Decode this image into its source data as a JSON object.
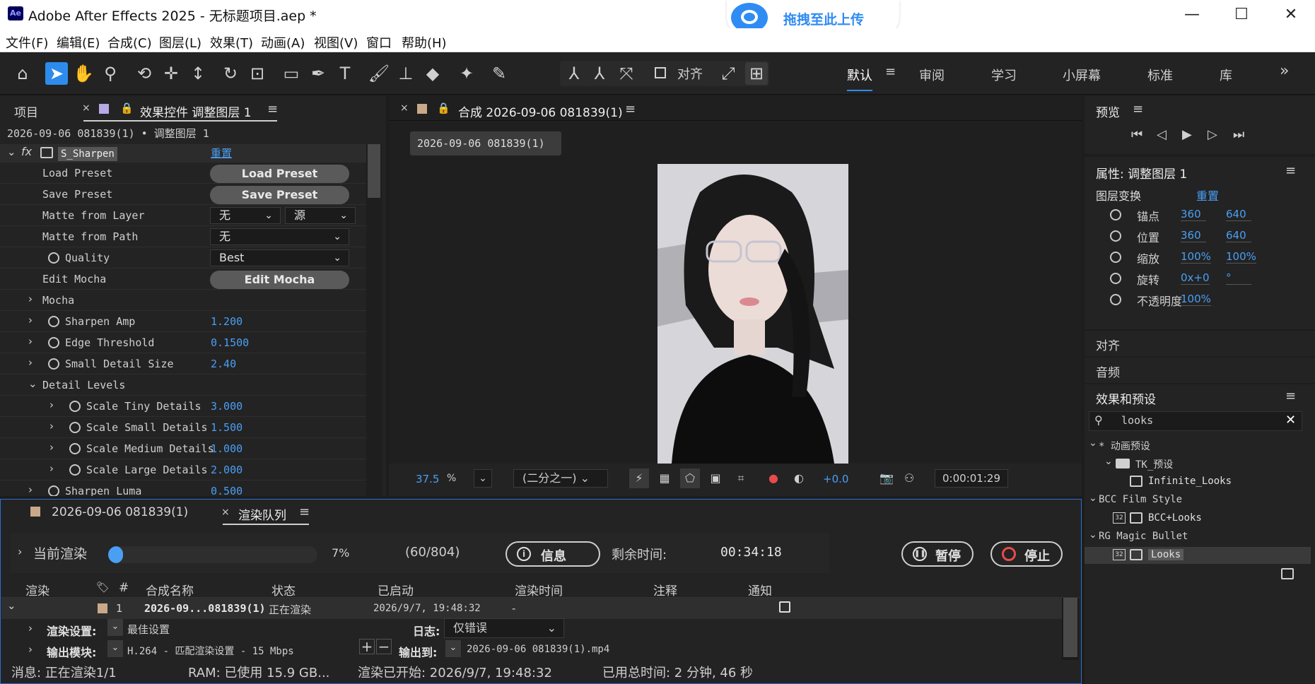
{
  "window": {
    "app_logo": "Ae",
    "title": "Adobe After Effects 2025 - 无标题项目.aep *",
    "upload_label": "拖拽至此上传",
    "controls": [
      "—",
      "☐",
      "✕"
    ]
  },
  "menu": [
    "文件(F)",
    "编辑(E)",
    "合成(C)",
    "图层(L)",
    "效果(T)",
    "动画(A)",
    "视图(V)",
    "窗口",
    "帮助(H)"
  ],
  "toolbar": {
    "align_label": "对齐",
    "workspaces": [
      "默认",
      "审阅",
      "学习",
      "小屏幕",
      "标准",
      "库"
    ],
    "more": "»"
  },
  "left_panel": {
    "tab_project": "项目",
    "tab_effects": "效果控件 调整图层 1",
    "breadcrumb": "2026-09-06 081839(1) • 调整图层 1",
    "effect_name": "S_Sharpen",
    "reset": "重置",
    "rows": [
      {
        "label": "Load Preset",
        "kind": "button",
        "value": "Load Preset"
      },
      {
        "label": "Save Preset",
        "kind": "button",
        "value": "Save Preset"
      },
      {
        "label": "Matte from Layer",
        "kind": "dual",
        "value": "无",
        "value2": "源"
      },
      {
        "label": "Matte from Path",
        "kind": "dropdown",
        "value": "无"
      },
      {
        "label": "Quality",
        "kind": "dropdown",
        "value": "Best"
      },
      {
        "label": "Edit Mocha",
        "kind": "button",
        "value": "Edit Mocha"
      },
      {
        "label": "Mocha",
        "kind": "group",
        "value": ""
      },
      {
        "label": "Sharpen Amp",
        "kind": "value",
        "value": "1.200"
      },
      {
        "label": "Edge Threshold",
        "kind": "value",
        "value": "0.1500"
      },
      {
        "label": "Small Detail Size",
        "kind": "value",
        "value": "2.40"
      },
      {
        "label": "Detail Levels",
        "kind": "group-open",
        "value": ""
      },
      {
        "label": "Scale Tiny Details",
        "kind": "value",
        "value": "3.000"
      },
      {
        "label": "Scale Small Details",
        "kind": "value",
        "value": "1.500"
      },
      {
        "label": "Scale Medium Details",
        "kind": "value",
        "value": "1.000"
      },
      {
        "label": "Scale Large Details",
        "kind": "value",
        "value": "2.000"
      },
      {
        "label": "Sharpen Luma",
        "kind": "value",
        "value": "0.500"
      }
    ]
  },
  "composition": {
    "tab": "合成 2026-09-06 081839(1)",
    "breadcrumb": "2026-09-06 081839(1)",
    "zoom": "37.5",
    "zoom_unit": "%",
    "resolution": "(二分之一)",
    "exposure": "+0.0",
    "timecode": "0:00:01:29"
  },
  "right_panel": {
    "preview_title": "预览",
    "properties_title": "属性: 调整图层 1",
    "layer_transform": "图层变换",
    "reset": "重置",
    "props": [
      {
        "name": "锚点",
        "v1": "360",
        "v2": "640"
      },
      {
        "name": "位置",
        "v1": "360",
        "v2": "640"
      },
      {
        "name": "缩放",
        "v1": "100%",
        "v2": "100%"
      },
      {
        "name": "旋转",
        "v1": "0x+0",
        "v2": "°"
      },
      {
        "name": "不透明度",
        "v1": "100%",
        "v2": ""
      }
    ],
    "align_title": "对齐",
    "audio_title": "音频",
    "effects_presets_title": "效果和预设",
    "search_value": "looks",
    "tree": [
      {
        "label": "* 动画预设",
        "indent": 0,
        "type": "folder-open"
      },
      {
        "label": "TK_预设",
        "indent": 1,
        "type": "folder-open"
      },
      {
        "label": "Infinite_Looks",
        "indent": 2,
        "type": "preset"
      },
      {
        "label": "BCC Film Style",
        "indent": 0,
        "type": "folder-open"
      },
      {
        "label": "BCC+Looks",
        "indent": 2,
        "type": "preset32"
      },
      {
        "label": "RG Magic Bullet",
        "indent": 0,
        "type": "folder-open"
      },
      {
        "label": "Looks",
        "indent": 2,
        "type": "preset32-selected"
      }
    ]
  },
  "render_queue": {
    "comp_tab": "2026-09-06 081839(1)",
    "tab": "渲染队列",
    "current_render": "当前渲染",
    "progress": 7,
    "progress_text": "7%",
    "frames": "(60/804)",
    "info_button": "信息",
    "remaining_label": "剩余时间:",
    "remaining": "00:34:18",
    "pause_button": "暂停",
    "stop_button": "停止",
    "columns": [
      "渲染",
      "#",
      "合成名称",
      "状态",
      "已启动",
      "渲染时间",
      "注释",
      "通知"
    ],
    "row": {
      "num": "1",
      "name": "2026-09...081839(1)",
      "status": "正在渲染",
      "started": "2026/9/7, 19:48:32",
      "render_time": "-"
    },
    "render_settings_label": "渲染设置:",
    "render_settings_value": "最佳设置",
    "log_label": "日志:",
    "log_value": "仅错误",
    "output_module_label": "输出模块:",
    "output_module_value": "H.264 - 匹配渲染设置 - 15 Mbps",
    "output_to_label": "输出到:",
    "output_to_value": "2026-09-06 081839(1).mp4",
    "status_message": "消息: 正在渲染1/1",
    "status_ram": "RAM: 已使用 15.9 GB...",
    "status_started": "渲染已开始: 2026/9/7, 19:48:32",
    "status_elapsed": "已用总时间: 2 分钟, 46 秒"
  }
}
